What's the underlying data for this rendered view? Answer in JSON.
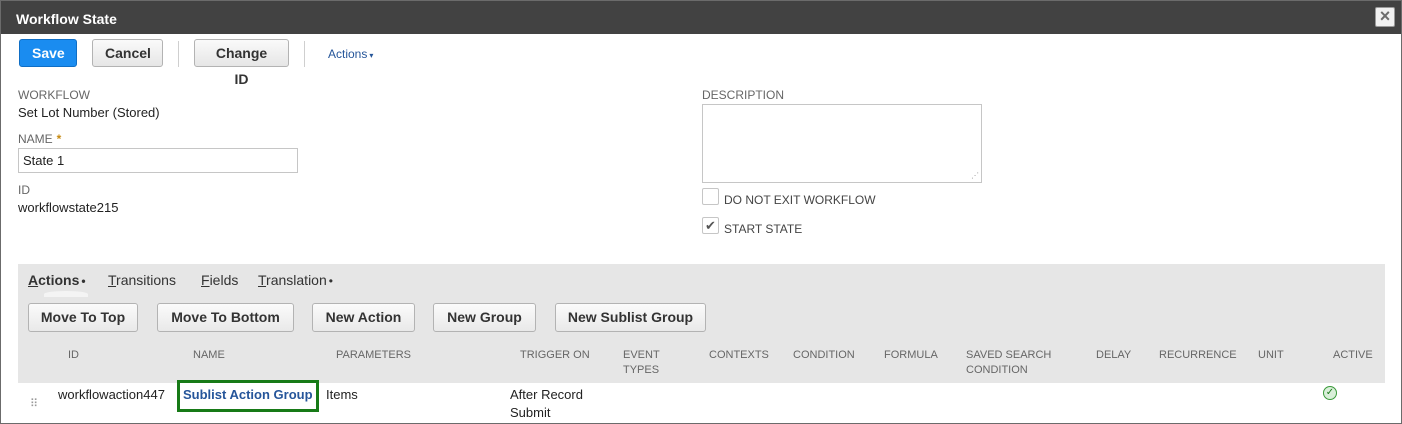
{
  "window": {
    "title": "Workflow State",
    "close_icon": "×"
  },
  "toolbar": {
    "save_label": "Save",
    "cancel_label": "Cancel",
    "change_id_label": "Change ID",
    "actions_label": "Actions",
    "actions_caret": "▾"
  },
  "form": {
    "workflow_label": "WORKFLOW",
    "workflow_value": "Set Lot Number (Stored)",
    "name_label": "NAME",
    "name_required_mark": "*",
    "name_value": "State 1",
    "id_label": "ID",
    "id_value": "workflowstate215",
    "description_label": "DESCRIPTION",
    "do_not_exit_label": "DO NOT EXIT WORKFLOW",
    "do_not_exit_checked": false,
    "start_state_label": "START STATE",
    "start_state_checked": true,
    "check_glyph": "✔"
  },
  "tabs": [
    {
      "access": "A",
      "rest": "ctions",
      "dot": "•"
    },
    {
      "access": "T",
      "rest": "ransitions",
      "dot": ""
    },
    {
      "access": "F",
      "rest": "ields",
      "dot": ""
    },
    {
      "access": "T",
      "rest": "ranslation",
      "dot": "•"
    }
  ],
  "sublist_buttons": {
    "move_top": "Move To Top",
    "move_bottom": "Move To Bottom",
    "new_action": "New Action",
    "new_group": "New Group",
    "new_sublist_group": "New Sublist Group"
  },
  "table": {
    "columns": {
      "id": "ID",
      "name": "NAME",
      "parameters": "PARAMETERS",
      "trigger_on": "TRIGGER ON",
      "event_types_1": "EVENT",
      "event_types_2": "TYPES",
      "contexts": "CONTEXTS",
      "condition": "CONDITION",
      "formula": "FORMULA",
      "saved_search_1": "SAVED SEARCH",
      "saved_search_2": "CONDITION",
      "delay": "DELAY",
      "recurrence": "RECURRENCE",
      "unit": "UNIT",
      "active": "ACTIVE"
    },
    "rows": [
      {
        "drag_glyph": "⠿",
        "id": "workflowaction447",
        "name": "Sublist Action Group",
        "parameters": "Items",
        "trigger_on_1": "After Record",
        "trigger_on_2": "Submit",
        "active_glyph": "✓",
        "active": true
      }
    ]
  }
}
